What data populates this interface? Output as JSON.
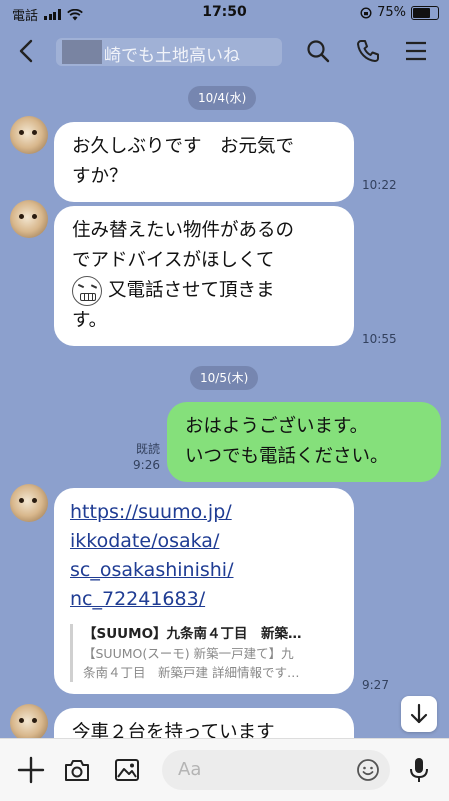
{
  "status": {
    "carrier": "電話",
    "time": "17:50",
    "battery": "75%",
    "battery_level": 0.75
  },
  "header": {
    "title": "崎でも土地高いね"
  },
  "chat": {
    "dates": [
      "10/4(水)",
      "10/5(木)"
    ],
    "messages": [
      {
        "lines": [
          "お久しぶりです　お元気で",
          "すか？"
        ],
        "time": "10:22"
      },
      {
        "lines": [
          "住み替えたい物件があるの",
          "でアドバイスがほしくて",
          "又電話させて頂きま",
          "す。"
        ],
        "time": "10:55"
      },
      {
        "lines": [
          "おはようございます。",
          "いつでも電話ください。"
        ],
        "read": "既読",
        "time": "9:26"
      },
      {
        "links": [
          "https://suumo.jp/",
          "ikkodate/osaka/",
          "sc_osakashinishi/",
          "nc_72241683/"
        ],
        "preview_title": "【SUUMO】九条南４丁目　新築…",
        "preview_desc": [
          "【SUUMO(スーモ) 新築一戸建て】九",
          "条南４丁目　新築戸建 詳細情報です…"
        ],
        "time": "9:27"
      },
      {
        "lines": [
          "今車２台を持っています"
        ]
      }
    ]
  },
  "input": {
    "placeholder": "Aa"
  },
  "icons": {
    "back": "back-chevron-icon",
    "search": "search-icon",
    "call": "phone-icon",
    "menu": "menu-icon",
    "plus": "plus-icon",
    "camera": "camera-icon",
    "image": "image-icon",
    "emoji": "emoji-icon",
    "mic": "microphone-icon",
    "scroll_down": "arrow-down-icon"
  },
  "colors": {
    "background": "#8ca0cd",
    "bubble_incoming": "#ffffff",
    "bubble_outgoing": "#85e07b",
    "link": "#1f3c93"
  }
}
